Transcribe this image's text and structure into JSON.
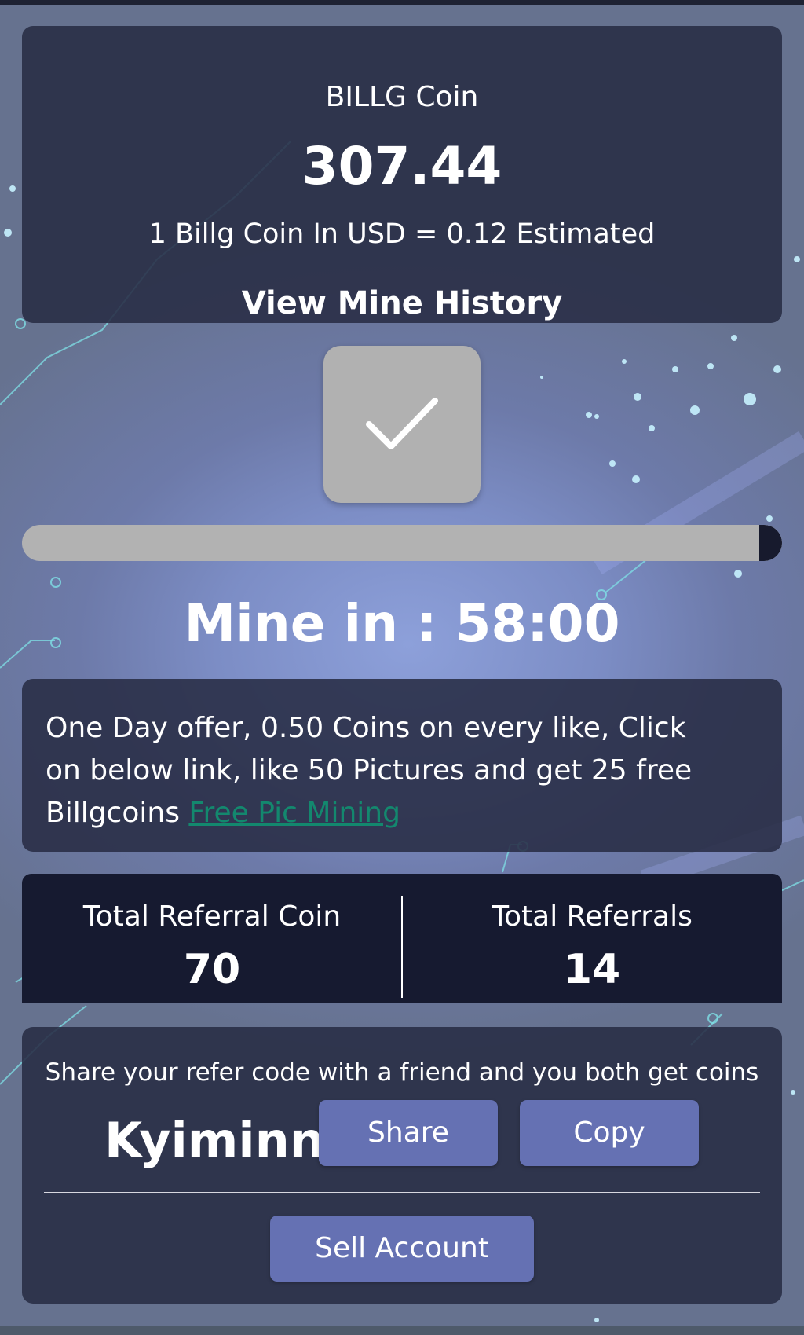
{
  "coin": {
    "title": "BILLG Coin",
    "balance": "307.44",
    "rate_text": "1 Billg Coin In USD = 0.12 Estimated",
    "history_link": "View Mine History"
  },
  "mine_button": {
    "icon": "check-icon"
  },
  "progress": {
    "fraction_remaining": 0.03
  },
  "timer": {
    "text": "Mine in : 58:00"
  },
  "offer": {
    "text": "One Day offer, 0.50 Coins on every like, Click on below link, like 50 Pictures and get 25 free Billgcoins ",
    "link_text": "Free Pic Mining "
  },
  "stats": {
    "referral_coin_label": "Total Referral Coin",
    "referral_coin_value": "70",
    "referrals_label": "Total Referrals",
    "referrals_value": "14"
  },
  "refer": {
    "text": "Share your refer code with a friend and you both get coins",
    "code": "Kyiminn",
    "share_label": "Share",
    "copy_label": "Copy",
    "sell_label": "Sell Account"
  },
  "colors": {
    "panel": "#282c44",
    "stats_panel": "#161a30",
    "button": "#6571b3",
    "link": "#13886e",
    "progress_track": "#b2b2b2",
    "progress_fill": "#171a2d"
  }
}
